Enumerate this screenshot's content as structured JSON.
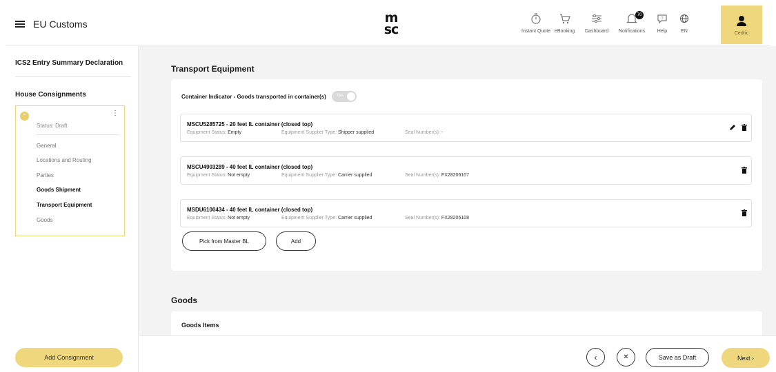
{
  "header": {
    "app_title": "EU Customs",
    "logo_text": "msc",
    "nav": [
      {
        "label": "Instant Quote",
        "icon": "timer-icon"
      },
      {
        "label": "eBooking",
        "icon": "cart-icon"
      },
      {
        "label": "Dashboard",
        "icon": "sliders-icon"
      },
      {
        "label": "Notifications",
        "icon": "bell-icon",
        "badge": "70"
      },
      {
        "label": "Help",
        "icon": "help-chat-icon"
      },
      {
        "label": "EN",
        "icon": "globe-icon"
      }
    ],
    "user_name": "Cedric"
  },
  "sidebar": {
    "title": "ICS2 Entry Summary Declaration",
    "section": "House Consignments",
    "consignment": {
      "status": "Status: Draft",
      "items": [
        "General",
        "Locations and Routing",
        "Parties",
        "Goods Shipment",
        "Transport Equipment",
        "Goods"
      ],
      "active_items": [
        "Goods Shipment",
        "Transport Equipment"
      ]
    },
    "add_button": "Add Consignment"
  },
  "main": {
    "transport_title": "Transport Equipment",
    "container_indicator": "Container Indicator - Goods transported in container(s)",
    "toggle_label": "Yes",
    "equipment": [
      {
        "title": "MSCU5285725 - 20 feet IL container (closed top)",
        "status_label": "Equipment Status:",
        "status": "Empty",
        "supplier_label": "Equipment Supplier Type:",
        "supplier": "Shipper supplied",
        "seal_label": "Seal Number(s):",
        "seal": "-",
        "editable": true
      },
      {
        "title": "MSCU4903289 - 40 feet IL container (closed top)",
        "status_label": "Equipment Status:",
        "status": "Not empty",
        "supplier_label": "Equipment Supplier Type:",
        "supplier": "Carrier supplied",
        "seal_label": "Seal Number(s):",
        "seal": "FX28206107",
        "editable": false
      },
      {
        "title": "MSDU6100434 - 40 feet IL container (closed top)",
        "status_label": "Equipment Status:",
        "status": "Not empty",
        "supplier_label": "Equipment Supplier Type:",
        "supplier": "Carrier supplied",
        "seal_label": "Seal Number(s):",
        "seal": "FX28206108",
        "editable": false
      }
    ],
    "pick_button": "Pick from Master BL",
    "add_button": "Add",
    "goods_title": "Goods",
    "goods_items_title": "Goods Items"
  },
  "footer": {
    "prev_symbol": "‹",
    "close_symbol": "✕",
    "save_draft": "Save as Draft",
    "next": "Next ›"
  },
  "colors": {
    "accent": "#eed77c",
    "background": "#f3f3f4"
  }
}
